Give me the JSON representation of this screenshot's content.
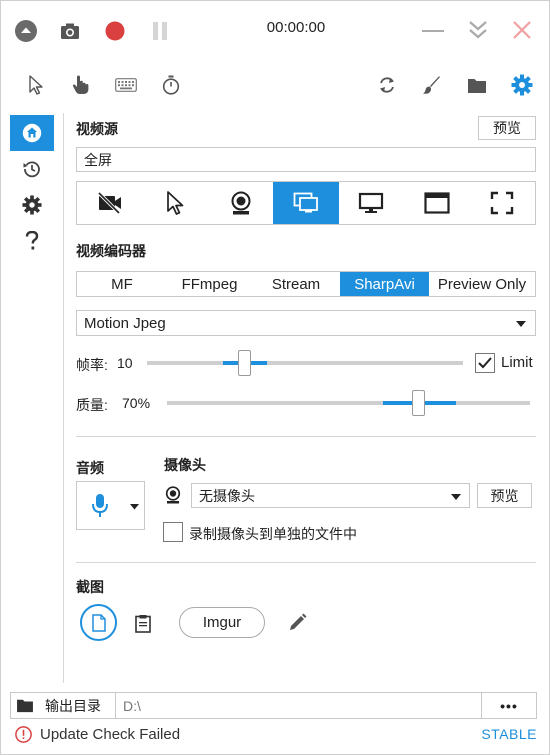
{
  "titlebar": {
    "timer": "00:00:00"
  },
  "icons": {
    "collapse": "chevron-up-circle-icon",
    "screenshot": "camera-icon",
    "record": "record-icon",
    "pause": "pause-icon",
    "minimize": "minimize-icon",
    "tray": "double-chevron-down-icon",
    "close": "close-icon"
  },
  "colors": {
    "accent": "#1e8fdc",
    "record": "#d9403f",
    "close": "#f0a0a0",
    "error": "#d9403f"
  },
  "video_source": {
    "heading": "视频源",
    "preview_label": "预览",
    "current": "全屏",
    "sources": [
      "no-video",
      "cursor",
      "webcam",
      "screen",
      "desktop",
      "window",
      "region"
    ],
    "active_index": 3
  },
  "video_encoder": {
    "heading": "视频编码器",
    "encoders": [
      "MF",
      "FFmpeg",
      "Stream",
      "SharpAvi",
      "Preview Only"
    ],
    "active_index": 3,
    "codec": "Motion Jpeg"
  },
  "framerate": {
    "label": "帧率:",
    "value": "10",
    "limit_label": "Limit",
    "limit_checked": true
  },
  "quality": {
    "label": "质量:",
    "value": "70%"
  },
  "audio": {
    "heading": "音频"
  },
  "webcam": {
    "heading": "摄像头",
    "selected": "无摄像头",
    "preview_label": "预览",
    "separate_file_label": "录制摄像头到单独的文件中",
    "separate_file_checked": false
  },
  "screenshot": {
    "heading": "截图",
    "imgur_label": "Imgur"
  },
  "output": {
    "label": "输出目录",
    "path": "D:\\",
    "more": "•••"
  },
  "status": {
    "message": "Update Check Failed",
    "channel": "STABLE"
  }
}
